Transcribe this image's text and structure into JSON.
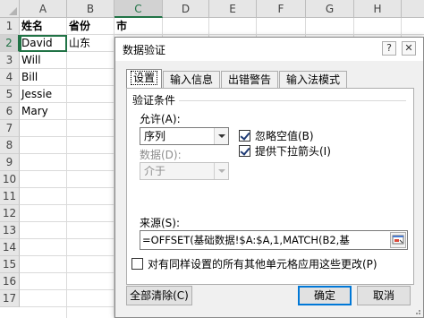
{
  "sheet": {
    "columns": [
      "A",
      "B",
      "C",
      "D",
      "E",
      "F",
      "G",
      "H"
    ],
    "selected_column": "C",
    "rows": [
      "1",
      "2",
      "3",
      "4",
      "5",
      "6",
      "7",
      "8",
      "9",
      "10",
      "11",
      "12",
      "13",
      "14",
      "15",
      "16",
      "17"
    ],
    "selected_row": "2",
    "headers": {
      "a1": "姓名",
      "b1": "省份",
      "c1": "市"
    },
    "names": [
      "David",
      "Will",
      "Bill",
      "Jessie",
      "Mary"
    ],
    "b2": "山东"
  },
  "dialog": {
    "title": "数据验证",
    "help_label": "?",
    "close_label": "✕",
    "tabs": [
      "设置",
      "输入信息",
      "出错警告",
      "输入法模式"
    ],
    "section_title": "验证条件",
    "allow_label": "允许(A):",
    "allow_value": "序列",
    "data_label": "数据(D):",
    "data_value": "介于",
    "ignore_blank_label": "忽略空值(B)",
    "ignore_blank_checked": true,
    "dropdown_label": "提供下拉箭头(I)",
    "dropdown_checked": true,
    "source_label": "来源(S):",
    "source_value": "=OFFSET(基础数据!$A:$A,1,MATCH(B2,基",
    "apply_all_label": "对有同样设置的所有其他单元格应用这些更改(P)",
    "apply_all_checked": false,
    "clear_all_label": "全部清除(C)",
    "ok_label": "确定",
    "cancel_label": "取消"
  }
}
